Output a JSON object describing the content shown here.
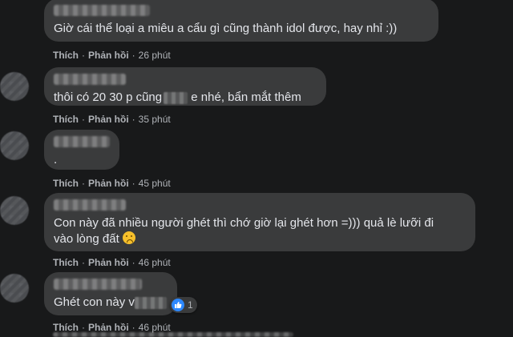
{
  "actions": {
    "like": "Thích",
    "reply": "Phản hồi",
    "separator": "·"
  },
  "comments": [
    {
      "text": "Giờ cái thể loại a miêu a cẩu gì cũng thành idol được, hay nhỉ :))",
      "time": "26 phút"
    },
    {
      "text_before": "thôi có 20 30 p cũng",
      "text_after": " e nhé, bẩn mắt thêm",
      "time": "35 phút"
    },
    {
      "text": ".",
      "time": "45 phút"
    },
    {
      "line1": "Con này đã nhiều người ghét thì chớ giờ lại ghét hơn =))) quả lè lưỡi đi",
      "line2": "vào lòng đất",
      "emoji": "face-emoji",
      "time": "46 phút"
    },
    {
      "text": "Ghét con này v",
      "reaction_count": "1",
      "time": "46 phút"
    }
  ],
  "colors": {
    "background": "#18191a",
    "bubble": "#3a3b3c",
    "text": "#e4e6eb",
    "meta": "#b0b3b8",
    "like_blue": "#2d88ff"
  }
}
